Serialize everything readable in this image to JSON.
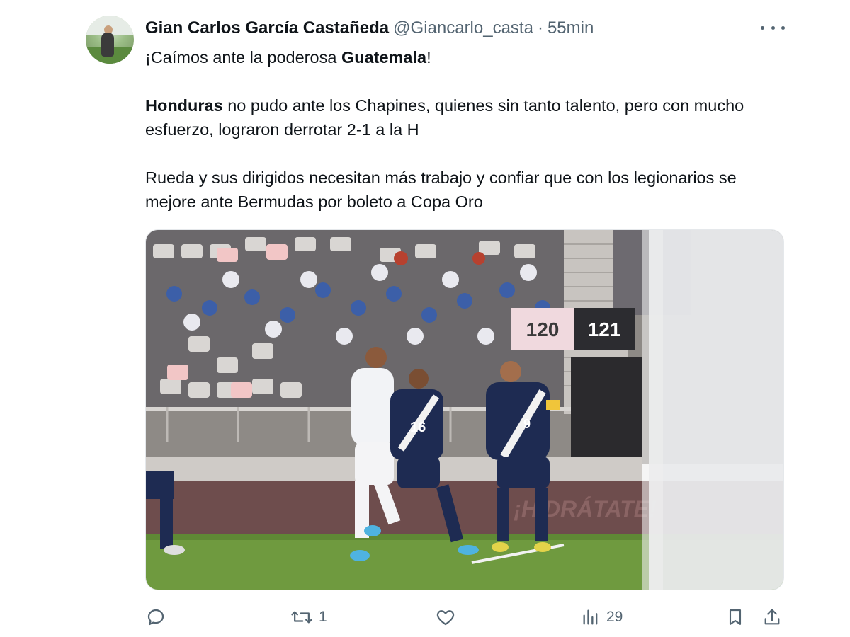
{
  "author": {
    "name": "Gian Carlos García Castañeda",
    "handle": "@Giancarlo_casta",
    "separator": "·",
    "time": "55min"
  },
  "tweet": {
    "line1_pre": "¡Caímos ante la poderosa ",
    "line1_bold": "Guatemala",
    "line1_post": "!",
    "para2_bold": "Honduras",
    "para2_rest": " no pudo ante los Chapines, quienes sin tanto talento, pero con mucho esfuerzo, lograron derrotar 2-1 a la H",
    "para3": "Rueda y sus dirigidos necesitan más trabajo y confiar que con los legionarios se mejore ante Bermudas por boleto a Copa Oro"
  },
  "media": {
    "board_left": "120",
    "board_right": "121",
    "jersey_a": "16",
    "jersey_b": "9",
    "banner_text": "¡HIDRÁTATE!"
  },
  "actions": {
    "reply_icon": "reply-icon",
    "retweet_icon": "retweet-icon",
    "retweet_count": "1",
    "like_icon": "heart-icon",
    "views_icon": "views-icon",
    "views_count": "29",
    "bookmark_icon": "bookmark-icon",
    "share_icon": "share-icon"
  },
  "colors": {
    "text": "#0f1419",
    "secondary": "#536471",
    "border": "#e5e8eb"
  }
}
